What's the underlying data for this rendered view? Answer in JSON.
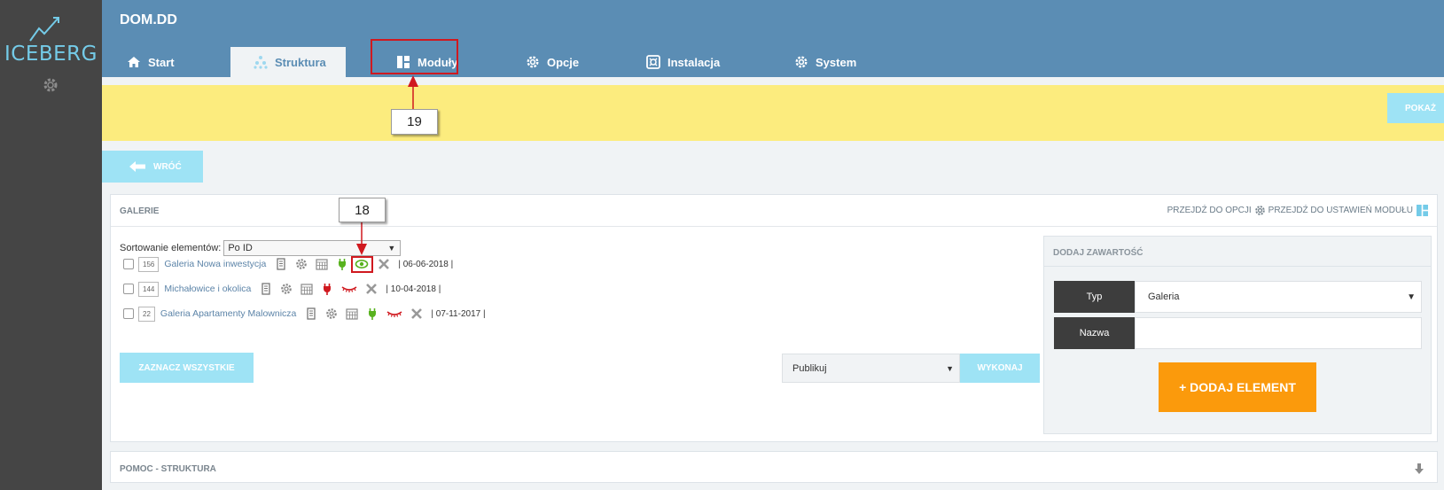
{
  "sidebar": {
    "logo_text": "ICEBERG",
    "settings_icon": "gear-icon"
  },
  "header": {
    "title": "DOM.DD",
    "tabs": [
      {
        "label": "Start",
        "icon": "home-icon"
      },
      {
        "label": "Struktura",
        "icon": "structure-icon"
      },
      {
        "label": "Moduły",
        "icon": "modules-icon"
      },
      {
        "label": "Opcje",
        "icon": "gear-icon"
      },
      {
        "label": "Instalacja",
        "icon": "install-icon"
      },
      {
        "label": "System",
        "icon": "gear-icon"
      }
    ],
    "active_tab": "Struktura"
  },
  "notice": {
    "show_button": "POKAŻ"
  },
  "back_button": "WRÓĆ",
  "panel": {
    "title": "GALERIE",
    "link_options": "PRZEJDŹ DO OPCJI",
    "link_module_settings": "PRZEJDŹ DO USTAWIEŃ MODUŁU",
    "sort_label": "Sortowanie elementów:",
    "sort_value": "Po ID",
    "items": [
      {
        "id": "156",
        "name": "Galeria Nowa inwestycja",
        "date": "| 06-06-2018 |",
        "published": true,
        "visible": true
      },
      {
        "id": "144",
        "name": "Michałowice i okolica",
        "date": "| 10-04-2018 |",
        "published": false,
        "visible": false
      },
      {
        "id": "22",
        "name": "Galeria Apartamenty Malownicza",
        "date": "| 07-11-2017 |",
        "published": true,
        "visible": false
      }
    ],
    "select_all": "ZAZNACZ WSZYSTKIE",
    "action_value": "Publikuj",
    "execute": "WYKONAJ"
  },
  "add_content": {
    "title": "DODAJ ZAWARTOŚĆ",
    "type_label": "Typ",
    "type_value": "Galeria",
    "name_label": "Nazwa",
    "name_value": "",
    "add_button": "+ DODAJ ELEMENT"
  },
  "help": {
    "title": "POMOC - STRUKTURA"
  },
  "annotations": {
    "callout_19": "19",
    "callout_18": "18",
    "color": "#d0191f"
  },
  "colors": {
    "header": "#5b8db4",
    "sidebar": "#454545",
    "notice": "#fcec7e",
    "light_button": "#9ee3f5",
    "add_button": "#fb9a0c"
  }
}
